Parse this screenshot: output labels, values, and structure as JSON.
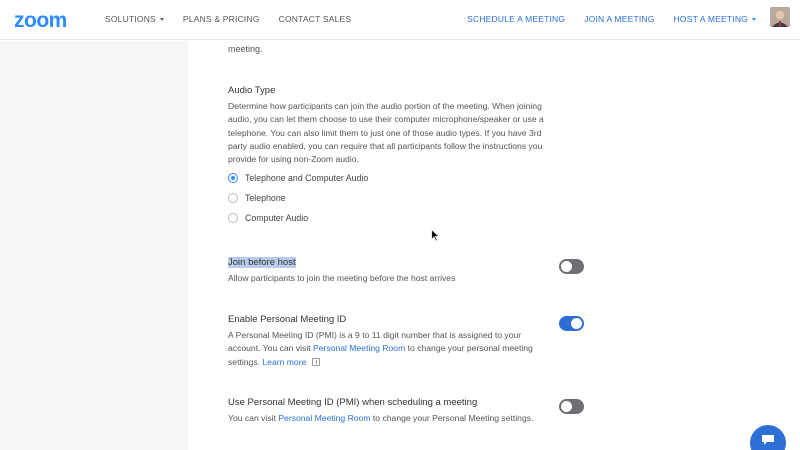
{
  "nav": {
    "logo": "zoom",
    "links": [
      "SOLUTIONS",
      "PLANS & PRICING",
      "CONTACT SALES"
    ],
    "right_links": [
      "SCHEDULE A MEETING",
      "JOIN A MEETING",
      "HOST A MEETING"
    ]
  },
  "content": {
    "clipped_text": "meeting.",
    "audio_type": {
      "title": "Audio Type",
      "description": "Determine how participants can join the audio portion of the meeting. When joining audio, you can let them choose to use their computer microphone/speaker or use a telephone. You can also limit them to just one of those audio types. If you have 3rd party audio enabled, you can require that all participants follow the instructions you provide for using non-Zoom audio.",
      "options": [
        "Telephone and Computer Audio",
        "Telephone",
        "Computer Audio"
      ],
      "selected": "Telephone and Computer Audio"
    },
    "join_before_host": {
      "title": "Join before host",
      "description": "Allow participants to join the meeting before the host arrives",
      "enabled": false
    },
    "pmi": {
      "title": "Enable Personal Meeting ID",
      "desc_1": "A Personal Meeting ID (PMI) is a 9 to 11 digit number that is assigned to your account. You can visit ",
      "link": "Personal Meeting Room",
      "desc_2": " to change your personal meeting settings. ",
      "learn_more": "Learn more",
      "enabled": true
    },
    "pmi_scheduling": {
      "title": "Use Personal Meeting ID (PMI) when scheduling a meeting",
      "desc_1": "You can visit ",
      "link": "Personal Meeting Room",
      "desc_2": " to change your Personal Meeting settings.",
      "enabled": false
    }
  },
  "colors": {
    "brand": "#2d8cff",
    "link": "#2d6fd6",
    "toggle_off": "#6e6f74",
    "highlight": "#b9cdea"
  }
}
